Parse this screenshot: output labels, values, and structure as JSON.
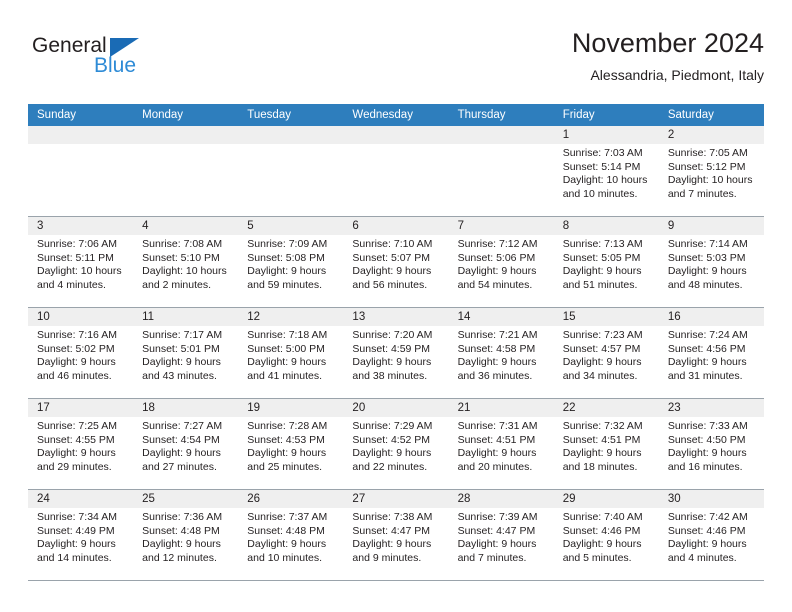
{
  "logo": {
    "word_top": "General",
    "word_bottom": "Blue",
    "triangle_color": "#1a6bb5",
    "blue_text_color": "#2e8bd6"
  },
  "header": {
    "title": "November 2024",
    "subtitle": "Alessandria, Piedmont, Italy"
  },
  "theme": {
    "header_row_bg": "#2e7ebd",
    "daynum_band_bg": "#efefef",
    "grid_line": "#9aa3ab",
    "text": "#231f20"
  },
  "weekdays": [
    "Sunday",
    "Monday",
    "Tuesday",
    "Wednesday",
    "Thursday",
    "Friday",
    "Saturday"
  ],
  "weeks": [
    [
      {
        "day": "",
        "sunrise": "",
        "sunset": "",
        "daylight": ""
      },
      {
        "day": "",
        "sunrise": "",
        "sunset": "",
        "daylight": ""
      },
      {
        "day": "",
        "sunrise": "",
        "sunset": "",
        "daylight": ""
      },
      {
        "day": "",
        "sunrise": "",
        "sunset": "",
        "daylight": ""
      },
      {
        "day": "",
        "sunrise": "",
        "sunset": "",
        "daylight": ""
      },
      {
        "day": "1",
        "sunrise": "Sunrise: 7:03 AM",
        "sunset": "Sunset: 5:14 PM",
        "daylight": "Daylight: 10 hours and 10 minutes."
      },
      {
        "day": "2",
        "sunrise": "Sunrise: 7:05 AM",
        "sunset": "Sunset: 5:12 PM",
        "daylight": "Daylight: 10 hours and 7 minutes."
      }
    ],
    [
      {
        "day": "3",
        "sunrise": "Sunrise: 7:06 AM",
        "sunset": "Sunset: 5:11 PM",
        "daylight": "Daylight: 10 hours and 4 minutes."
      },
      {
        "day": "4",
        "sunrise": "Sunrise: 7:08 AM",
        "sunset": "Sunset: 5:10 PM",
        "daylight": "Daylight: 10 hours and 2 minutes."
      },
      {
        "day": "5",
        "sunrise": "Sunrise: 7:09 AM",
        "sunset": "Sunset: 5:08 PM",
        "daylight": "Daylight: 9 hours and 59 minutes."
      },
      {
        "day": "6",
        "sunrise": "Sunrise: 7:10 AM",
        "sunset": "Sunset: 5:07 PM",
        "daylight": "Daylight: 9 hours and 56 minutes."
      },
      {
        "day": "7",
        "sunrise": "Sunrise: 7:12 AM",
        "sunset": "Sunset: 5:06 PM",
        "daylight": "Daylight: 9 hours and 54 minutes."
      },
      {
        "day": "8",
        "sunrise": "Sunrise: 7:13 AM",
        "sunset": "Sunset: 5:05 PM",
        "daylight": "Daylight: 9 hours and 51 minutes."
      },
      {
        "day": "9",
        "sunrise": "Sunrise: 7:14 AM",
        "sunset": "Sunset: 5:03 PM",
        "daylight": "Daylight: 9 hours and 48 minutes."
      }
    ],
    [
      {
        "day": "10",
        "sunrise": "Sunrise: 7:16 AM",
        "sunset": "Sunset: 5:02 PM",
        "daylight": "Daylight: 9 hours and 46 minutes."
      },
      {
        "day": "11",
        "sunrise": "Sunrise: 7:17 AM",
        "sunset": "Sunset: 5:01 PM",
        "daylight": "Daylight: 9 hours and 43 minutes."
      },
      {
        "day": "12",
        "sunrise": "Sunrise: 7:18 AM",
        "sunset": "Sunset: 5:00 PM",
        "daylight": "Daylight: 9 hours and 41 minutes."
      },
      {
        "day": "13",
        "sunrise": "Sunrise: 7:20 AM",
        "sunset": "Sunset: 4:59 PM",
        "daylight": "Daylight: 9 hours and 38 minutes."
      },
      {
        "day": "14",
        "sunrise": "Sunrise: 7:21 AM",
        "sunset": "Sunset: 4:58 PM",
        "daylight": "Daylight: 9 hours and 36 minutes."
      },
      {
        "day": "15",
        "sunrise": "Sunrise: 7:23 AM",
        "sunset": "Sunset: 4:57 PM",
        "daylight": "Daylight: 9 hours and 34 minutes."
      },
      {
        "day": "16",
        "sunrise": "Sunrise: 7:24 AM",
        "sunset": "Sunset: 4:56 PM",
        "daylight": "Daylight: 9 hours and 31 minutes."
      }
    ],
    [
      {
        "day": "17",
        "sunrise": "Sunrise: 7:25 AM",
        "sunset": "Sunset: 4:55 PM",
        "daylight": "Daylight: 9 hours and 29 minutes."
      },
      {
        "day": "18",
        "sunrise": "Sunrise: 7:27 AM",
        "sunset": "Sunset: 4:54 PM",
        "daylight": "Daylight: 9 hours and 27 minutes."
      },
      {
        "day": "19",
        "sunrise": "Sunrise: 7:28 AM",
        "sunset": "Sunset: 4:53 PM",
        "daylight": "Daylight: 9 hours and 25 minutes."
      },
      {
        "day": "20",
        "sunrise": "Sunrise: 7:29 AM",
        "sunset": "Sunset: 4:52 PM",
        "daylight": "Daylight: 9 hours and 22 minutes."
      },
      {
        "day": "21",
        "sunrise": "Sunrise: 7:31 AM",
        "sunset": "Sunset: 4:51 PM",
        "daylight": "Daylight: 9 hours and 20 minutes."
      },
      {
        "day": "22",
        "sunrise": "Sunrise: 7:32 AM",
        "sunset": "Sunset: 4:51 PM",
        "daylight": "Daylight: 9 hours and 18 minutes."
      },
      {
        "day": "23",
        "sunrise": "Sunrise: 7:33 AM",
        "sunset": "Sunset: 4:50 PM",
        "daylight": "Daylight: 9 hours and 16 minutes."
      }
    ],
    [
      {
        "day": "24",
        "sunrise": "Sunrise: 7:34 AM",
        "sunset": "Sunset: 4:49 PM",
        "daylight": "Daylight: 9 hours and 14 minutes."
      },
      {
        "day": "25",
        "sunrise": "Sunrise: 7:36 AM",
        "sunset": "Sunset: 4:48 PM",
        "daylight": "Daylight: 9 hours and 12 minutes."
      },
      {
        "day": "26",
        "sunrise": "Sunrise: 7:37 AM",
        "sunset": "Sunset: 4:48 PM",
        "daylight": "Daylight: 9 hours and 10 minutes."
      },
      {
        "day": "27",
        "sunrise": "Sunrise: 7:38 AM",
        "sunset": "Sunset: 4:47 PM",
        "daylight": "Daylight: 9 hours and 9 minutes."
      },
      {
        "day": "28",
        "sunrise": "Sunrise: 7:39 AM",
        "sunset": "Sunset: 4:47 PM",
        "daylight": "Daylight: 9 hours and 7 minutes."
      },
      {
        "day": "29",
        "sunrise": "Sunrise: 7:40 AM",
        "sunset": "Sunset: 4:46 PM",
        "daylight": "Daylight: 9 hours and 5 minutes."
      },
      {
        "day": "30",
        "sunrise": "Sunrise: 7:42 AM",
        "sunset": "Sunset: 4:46 PM",
        "daylight": "Daylight: 9 hours and 4 minutes."
      }
    ]
  ]
}
